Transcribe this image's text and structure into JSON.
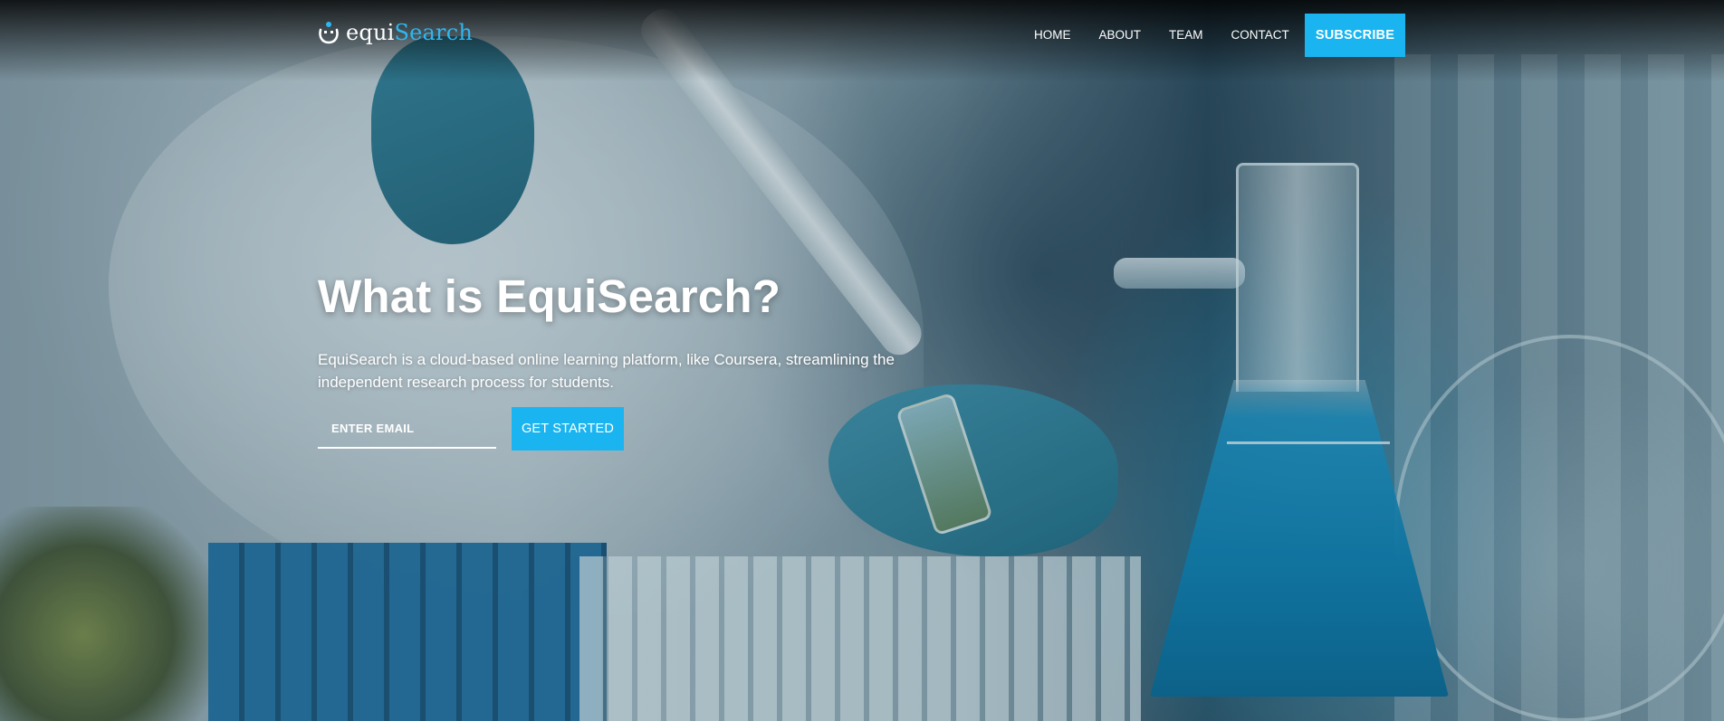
{
  "brand": {
    "prefix": "equi",
    "accent": "Search",
    "accent_color": "#2db7f1",
    "icon": "smiley-logo-icon"
  },
  "nav": {
    "links": [
      "HOME",
      "ABOUT",
      "TEAM",
      "CONTACT"
    ],
    "subscribe_label": "SUBSCRIBE",
    "button_color": "#1ab5f0"
  },
  "hero": {
    "title": "What is EquiSearch?",
    "subtitle": "EquiSearch is a cloud-based online learning platform, like Coursera, streamlining the independent research process for students.",
    "email_placeholder": "ENTER EMAIL",
    "cta_label": "GET STARTED"
  }
}
